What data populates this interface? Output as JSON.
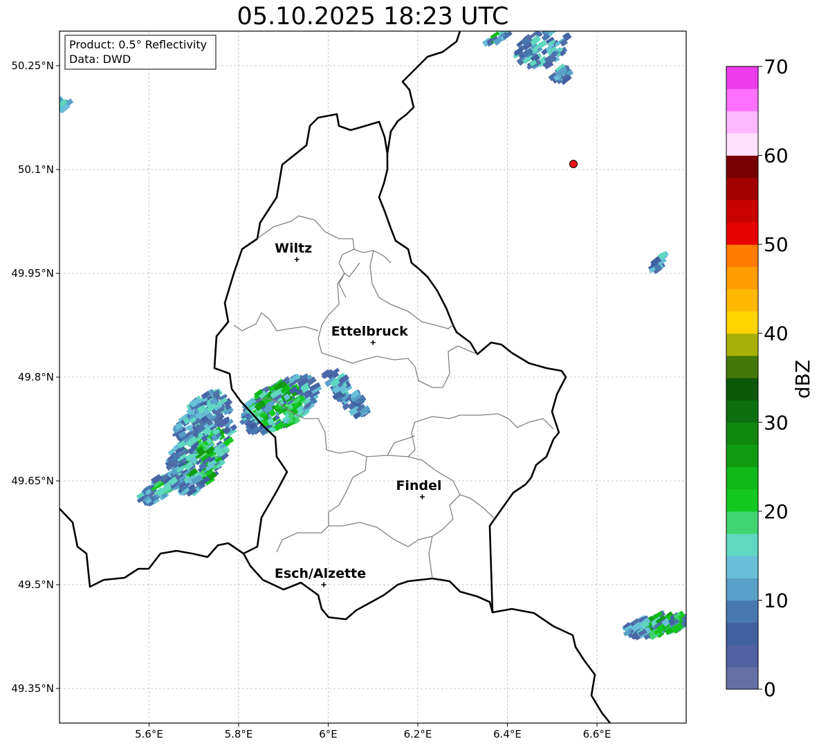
{
  "title": "05.10.2025 18:23 UTC",
  "info_box": {
    "product": "Product: 0.5° Reflectivity",
    "data": "Data: DWD"
  },
  "longitude_ticks": [
    "5.6°E",
    "5.8°E",
    "6°E",
    "6.2°E",
    "6.4°E",
    "6.6°E"
  ],
  "latitude_ticks": [
    "50.25°N",
    "50.1°N",
    "49.95°N",
    "49.8°N",
    "49.65°N",
    "49.5°N",
    "49.35°N"
  ],
  "cities": [
    {
      "name": "Wiltz",
      "lon": 5.93,
      "lat": 49.97
    },
    {
      "name": "Ettelbruck",
      "lon": 6.1,
      "lat": 49.85
    },
    {
      "name": "Findel",
      "lon": 6.21,
      "lat": 49.627
    },
    {
      "name": "Esch/Alzette",
      "lon": 5.99,
      "lat": 49.5
    }
  ],
  "radar_site_color": "#e8151b",
  "colorbar": {
    "label": "dBZ",
    "ticks": [
      "0",
      "10",
      "20",
      "30",
      "40",
      "50",
      "60",
      "70"
    ],
    "colors": [
      "#6470a5",
      "#5060a0",
      "#4060a0",
      "#4878b0",
      "#58a0c8",
      "#68c0d8",
      "#60d8c0",
      "#40d470",
      "#14c820",
      "#10b818",
      "#109c10",
      "#108810",
      "#0c7010",
      "#0a5808",
      "#447808",
      "#a8b008",
      "#ffd400",
      "#ffb800",
      "#ff9c00",
      "#ff7c00",
      "#e80000",
      "#c80000",
      "#a00000",
      "#780000",
      "#ffe0ff",
      "#ffb8ff",
      "#ff70ff",
      "#ec3cec"
    ]
  }
}
